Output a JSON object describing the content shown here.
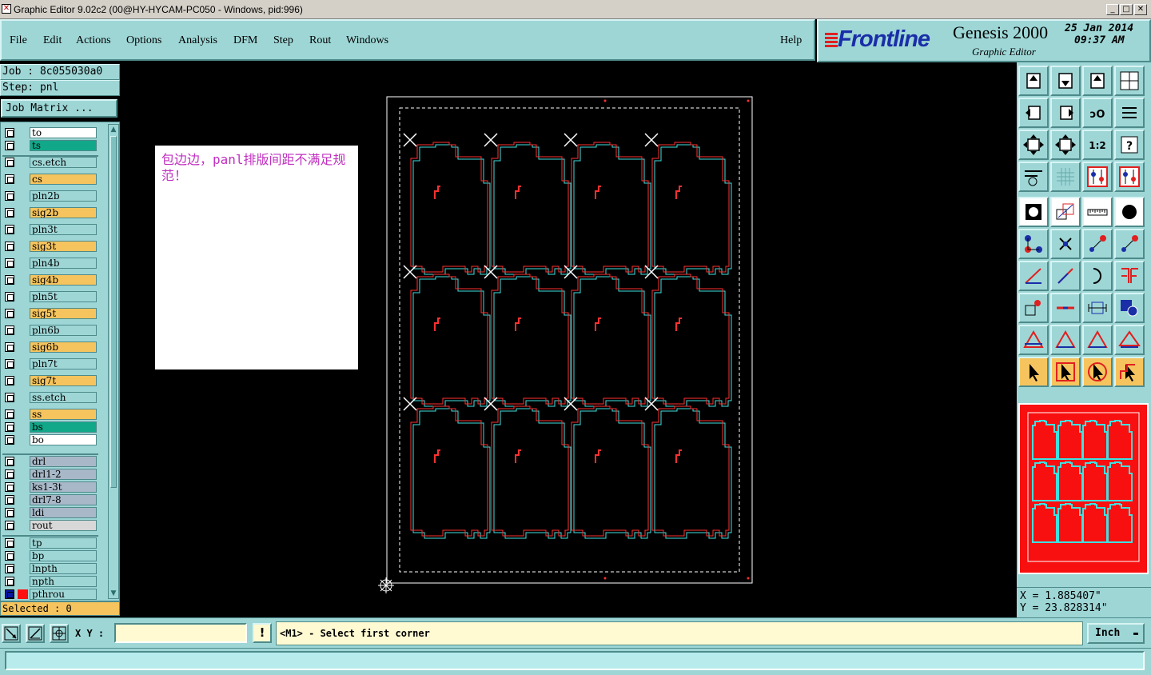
{
  "window": {
    "title": "Graphic Editor 9.02c2 (00@HY-HYCAM-PC050 - Windows, pid:996)",
    "buttons": [
      "_",
      "□",
      "✕"
    ]
  },
  "menu": [
    {
      "label": "File"
    },
    {
      "label": "Edit"
    },
    {
      "label": "Actions"
    },
    {
      "label": "Options"
    },
    {
      "label": "Analysis"
    },
    {
      "label": "DFM"
    },
    {
      "label": "Step"
    },
    {
      "label": "Rout"
    },
    {
      "label": "Windows"
    }
  ],
  "help": "Help",
  "brand": {
    "logo": "Frontline",
    "product": "Genesis 2000",
    "subtitle": "Graphic Editor",
    "date": "25 Jan 2014",
    "time": "09:37 AM"
  },
  "job": {
    "label": "Job : 8c055030a0"
  },
  "step": {
    "label": "Step: pnl"
  },
  "job_matrix": "Job Matrix ...",
  "layers": [
    {
      "name": "to",
      "color": "#ffffff"
    },
    {
      "name": "ts",
      "color": "#11a88a"
    },
    {
      "name": "cs.etch",
      "color": "#9ed6d6"
    },
    {
      "name": "cs",
      "color": "#f6c45e"
    },
    {
      "name": "pln2b",
      "color": "#9ed6d6"
    },
    {
      "name": "sig2b",
      "color": "#f6c45e"
    },
    {
      "name": "pln3t",
      "color": "#9ed6d6"
    },
    {
      "name": "sig3t",
      "color": "#f6c45e"
    },
    {
      "name": "pln4b",
      "color": "#9ed6d6"
    },
    {
      "name": "sig4b",
      "color": "#f6c45e"
    },
    {
      "name": "pln5t",
      "color": "#9ed6d6"
    },
    {
      "name": "sig5t",
      "color": "#f6c45e"
    },
    {
      "name": "pln6b",
      "color": "#9ed6d6"
    },
    {
      "name": "sig6b",
      "color": "#f6c45e"
    },
    {
      "name": "pln7t",
      "color": "#9ed6d6"
    },
    {
      "name": "sig7t",
      "color": "#f6c45e"
    },
    {
      "name": "ss.etch",
      "color": "#9ed6d6"
    },
    {
      "name": "ss",
      "color": "#f6c45e"
    },
    {
      "name": "bs",
      "color": "#11a88a"
    },
    {
      "name": "bo",
      "color": "#ffffff"
    },
    {
      "name": "drl",
      "color": "#a8b8c8"
    },
    {
      "name": "drl1-2",
      "color": "#a8b8c8"
    },
    {
      "name": "ks1-3t",
      "color": "#a8b8c8"
    },
    {
      "name": "drl7-8",
      "color": "#a8b8c8"
    },
    {
      "name": "ldi",
      "color": "#a8b8c8"
    },
    {
      "name": "rout",
      "color": "#d8d8d8"
    },
    {
      "name": "tp",
      "color": "#9ed6d6"
    },
    {
      "name": "bp",
      "color": "#9ed6d6"
    },
    {
      "name": "lnpth",
      "color": "#9ed6d6"
    },
    {
      "name": "npth",
      "color": "#9ed6d6"
    },
    {
      "name": "pthrou",
      "color": "#9ed6d6",
      "active": true
    }
  ],
  "selected": "Selected : 0",
  "note": "包边边，panl排版间距不满足规范！",
  "coords": {
    "x": "X =  1.885407\"",
    "y": "Y = 23.828314\""
  },
  "xy_label": "X Y :",
  "xy_value": "",
  "info_btn": "!",
  "prompt": "<M1> - Select first corner",
  "unit": "Inch",
  "unit_arrow": "▬",
  "colors": {
    "panel": "#9ed6d6",
    "orange": "#f6c45e",
    "green": "#11a88a",
    "profile_red": "#ff3030",
    "profile_cyan": "#40e0e0",
    "note_text": "#c030c0"
  },
  "tool_icons": [
    "zoom-home-icon",
    "zoom-back-icon",
    "zoom-step-icon",
    "zoom-window-icon",
    "pan-left-icon",
    "pan-right-icon",
    "mirror-icon",
    "redraw-icon",
    "fit-icon",
    "center-icon",
    "scale-1-2-icon",
    "help-question-icon",
    "properties-icon",
    "grid-icon",
    "layer-compare-icon",
    "layer-align-icon",
    "snap-pad-icon",
    "edit-shape-icon",
    "ruler-icon",
    "circle-icon",
    "net-icon",
    "cross-icon",
    "connect-icon",
    "move-point-icon",
    "line-icon",
    "draw-line-icon",
    "arc-icon",
    "feature-icon",
    "add-pad-icon",
    "split-line-icon",
    "measure-icon",
    "copy-icon",
    "triangle-icon",
    "triangle-up-icon",
    "triangle-arrow-icon",
    "triangle-wide-icon",
    "select-icon",
    "select-box-icon",
    "select-circle-icon",
    "select-net-icon"
  ]
}
